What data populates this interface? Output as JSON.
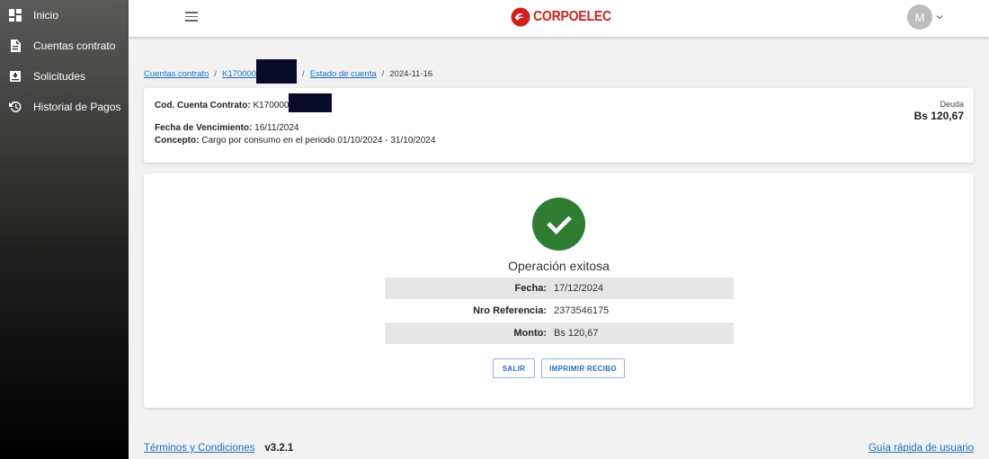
{
  "sidebar": {
    "items": [
      {
        "label": "Inicio",
        "icon": "dashboard-icon"
      },
      {
        "label": "Cuentas contrato",
        "icon": "document-icon"
      },
      {
        "label": "Solicitudes",
        "icon": "inbox-icon"
      },
      {
        "label": "Historial de Pagos",
        "icon": "history-icon"
      }
    ]
  },
  "topbar": {
    "brand": "CORPOELEC",
    "avatar_initial": "M"
  },
  "breadcrumb": {
    "item1": "Cuentas contrato",
    "item2": "K170000",
    "item3": "Estado de cuenta",
    "current": "2024-11-16"
  },
  "summary": {
    "account_label": "Cod. Cuenta Contrato:",
    "account_value": "K170000",
    "due_label": "Fecha de Vencimiento:",
    "due_value": "16/11/2024",
    "concept_label": "Concepto:",
    "concept_value": "Cargo por consumo en el periodo 01/10/2024 - 31/10/2024",
    "debt_label": "Deuda",
    "debt_amount": "Bs 120,67"
  },
  "result": {
    "title": "Operación exitosa",
    "rows": [
      {
        "label": "Fecha:",
        "value": "17/12/2024"
      },
      {
        "label": "Nro Referencia:",
        "value": "2373546175"
      },
      {
        "label": "Monto:",
        "value": "Bs 120,67"
      }
    ],
    "btn_exit": "SALIR",
    "btn_print": "IMPRIMIR RECIBO"
  },
  "footer": {
    "terms": "Términos y Condiciones",
    "version": "v3.2.1",
    "guide": "Guía rápida de usuario"
  },
  "colors": {
    "brand": "#d11f1f",
    "success": "#2e7d32",
    "link": "#1f6fbf"
  }
}
